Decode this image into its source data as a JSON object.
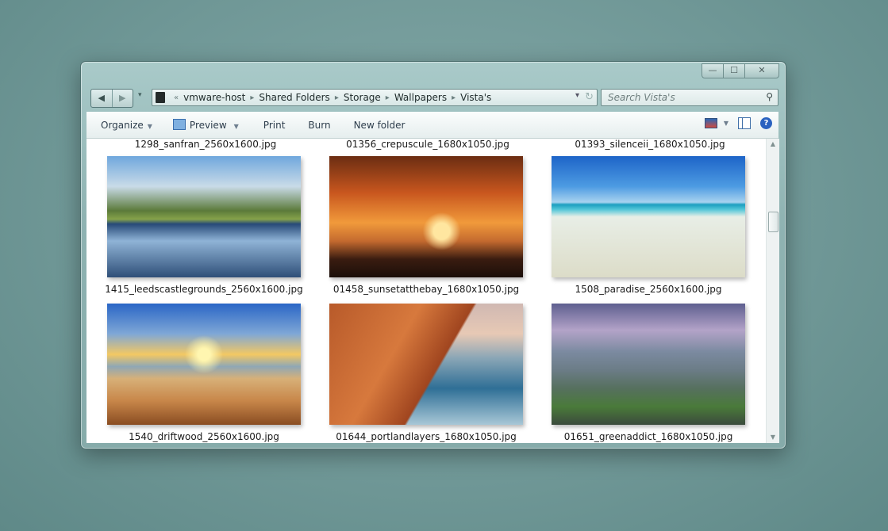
{
  "window": {
    "caption_buttons": {
      "minimize": "—",
      "maximize": "☐",
      "close": "✕"
    }
  },
  "nav": {
    "back": "◀",
    "forward": "▶",
    "recent": "▾",
    "address_overflow": "«",
    "breadcrumb": [
      "vmware-host",
      "Shared Folders",
      "Storage",
      "Wallpapers",
      "Vista's"
    ],
    "separator": "▸",
    "dropdown": "▾",
    "refresh": "↻"
  },
  "search": {
    "placeholder": "Search Vista's",
    "icon": "⚲"
  },
  "toolbar": {
    "organize": "Organize",
    "preview": "Preview",
    "print": "Print",
    "burn": "Burn",
    "new_folder": "New folder",
    "arrow": "▼",
    "help": "?"
  },
  "scroll": {
    "up": "▲",
    "down": "▼"
  },
  "files": {
    "top_row": [
      "1298_sanfran_2560x1600.jpg",
      "01356_crepuscule_1680x1050.jpg",
      "01393_silenceii_1680x1050.jpg"
    ],
    "row1": [
      "1415_leedscastlegrounds_2560x1600.jpg",
      "01458_sunsetatthebay_1680x1050.jpg",
      "1508_paradise_2560x1600.jpg"
    ],
    "row2": [
      "1540_driftwood_2560x1600.jpg",
      "01644_portlandlayers_1680x1050.jpg",
      "01651_greenaddict_1680x1050.jpg"
    ]
  }
}
